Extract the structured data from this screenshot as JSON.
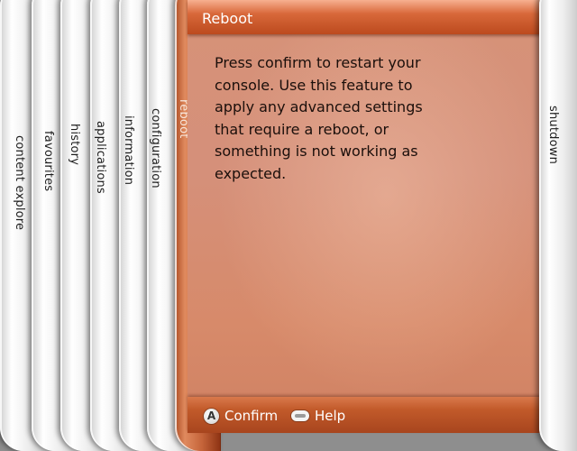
{
  "sidebar": {
    "items": [
      {
        "label": "content explore"
      },
      {
        "label": "favourites"
      },
      {
        "label": "history"
      },
      {
        "label": "applications"
      },
      {
        "label": "information"
      },
      {
        "label": "configuration"
      },
      {
        "label": "reboot"
      }
    ],
    "active_label": "reboot"
  },
  "panel": {
    "title": "Reboot",
    "description": "Press confirm to restart your console. Use this feature to apply any advanced settings that require a reboot, or something is not working as expected."
  },
  "footer": {
    "confirm_icon": "A",
    "confirm_label": "Confirm",
    "help_label": "Help"
  },
  "right_blade": {
    "label": "shutdown"
  },
  "colors": {
    "accent": "#c95a2c",
    "panel": "#d68f74",
    "blade": "#e9e9e9"
  }
}
